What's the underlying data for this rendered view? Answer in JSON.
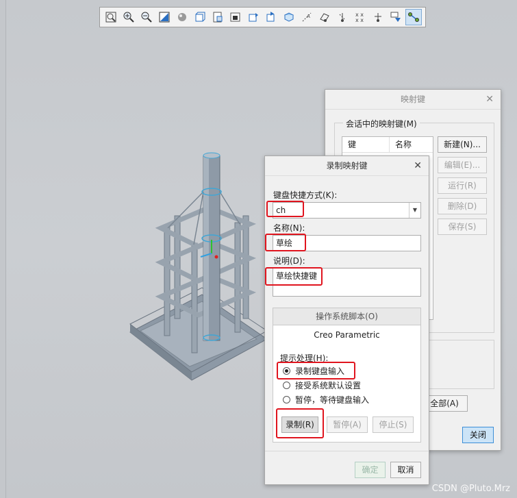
{
  "toolbar": {
    "icons": [
      "zoom-fit-icon",
      "zoom-in-icon",
      "zoom-out-icon",
      "refit-icon",
      "shading-icon",
      "view-cube-icon",
      "saved-views-icon",
      "display-style-icon",
      "appearance-icon",
      "datum-display-icon",
      "plane-display-icon",
      "axis-display-icon",
      "point-display-icon",
      "csys-display-icon",
      "annotation-display-icon",
      "spin-center-icon",
      "mapkey-icon"
    ]
  },
  "mapkeys_dialog": {
    "title": "映射键",
    "group_label": "会话中的映射键(M)",
    "columns": [
      "键",
      "名称"
    ],
    "new_label": "新建(N)...",
    "edit_label": "编辑(E)...",
    "run_label": "运行(R)",
    "delete_label": "删除(D)",
    "save_label": "保存(S)",
    "save_all_label": "全部(A)",
    "close_label": "关闭"
  },
  "record_dialog": {
    "title": "录制映射键",
    "shortcut_label": "键盘快捷方式(K):",
    "shortcut_value": "ch",
    "name_label": "名称(N):",
    "name_value": "草绘",
    "desc_label": "说明(D):",
    "desc_value": "草绘快捷键",
    "tab_os_script": "操作系统脚本(O)",
    "tab_creo": "Creo Parametric",
    "prompt_label": "提示处理(H):",
    "option_record": "录制键盘输入",
    "option_accept": "接受系统默认设置",
    "option_pause": "暂停，等待键盘输入",
    "record_label": "录制(R)",
    "pause_label": "暂停(A)",
    "stop_label": "停止(S)",
    "ok_label": "确定",
    "cancel_label": "取消"
  },
  "watermark": "CSDN @Pluto.Mrz"
}
